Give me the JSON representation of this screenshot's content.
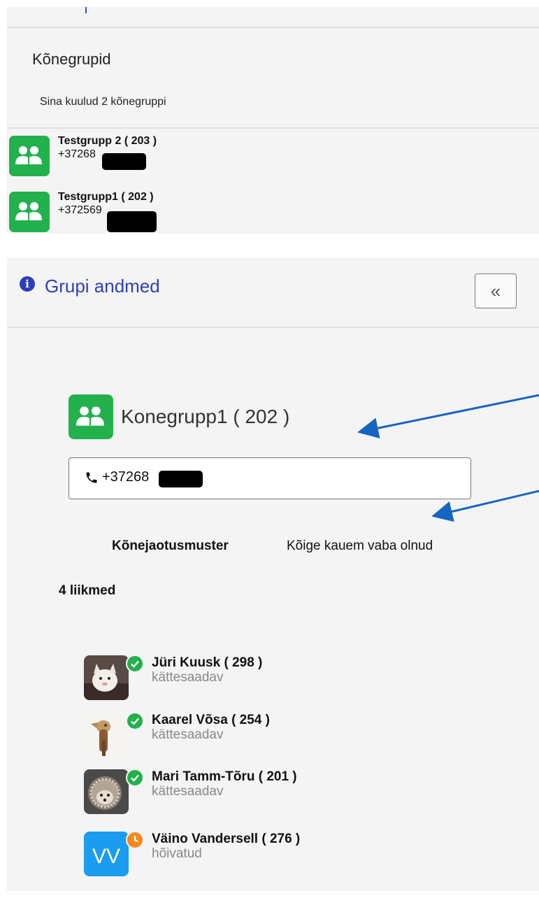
{
  "top_panel": {
    "section_title": "Kõnegrupid",
    "membership_text": "Sina kuulud 2 kõnegruppi",
    "groups": [
      {
        "name": "Testgrupp 2 ( 203 )",
        "number": "+37268"
      },
      {
        "name": "Testgrupp1 ( 202 )",
        "number": "+372569"
      }
    ]
  },
  "details": {
    "header_title": "Grupi andmed",
    "info_icon": "info-circle-icon",
    "collapse_icon": "double-chevron-left-icon",
    "collapse_glyph": "«",
    "group_name": "Konegrupp1 ( 202 )",
    "phone_icon": "phone-icon",
    "phone_number": "+37268",
    "pattern_label": "Kõnejaotusmuster",
    "pattern_value": "Kõige kauem vaba olnud",
    "members_count": "4 liikmed",
    "members": [
      {
        "name": "Jüri Kuusk ( 298 )",
        "status": "kättesaadav",
        "presence": "available"
      },
      {
        "name": "Kaarel Võsa ( 254 )",
        "status": "kättesaadav",
        "presence": "available"
      },
      {
        "name": "Mari Tamm-Tõru ( 201 )",
        "status": "kättesaadav",
        "presence": "available"
      },
      {
        "name": "Väino Vandersell ( 276 )",
        "status": "hõivatud",
        "presence": "busy",
        "initials": "VV"
      }
    ]
  },
  "colors": {
    "accent_blue": "#2f3fb7",
    "group_green": "#22b14c",
    "available_green": "#22b14c",
    "busy_orange": "#f5891f",
    "annotation_arrow": "#1565c0"
  }
}
